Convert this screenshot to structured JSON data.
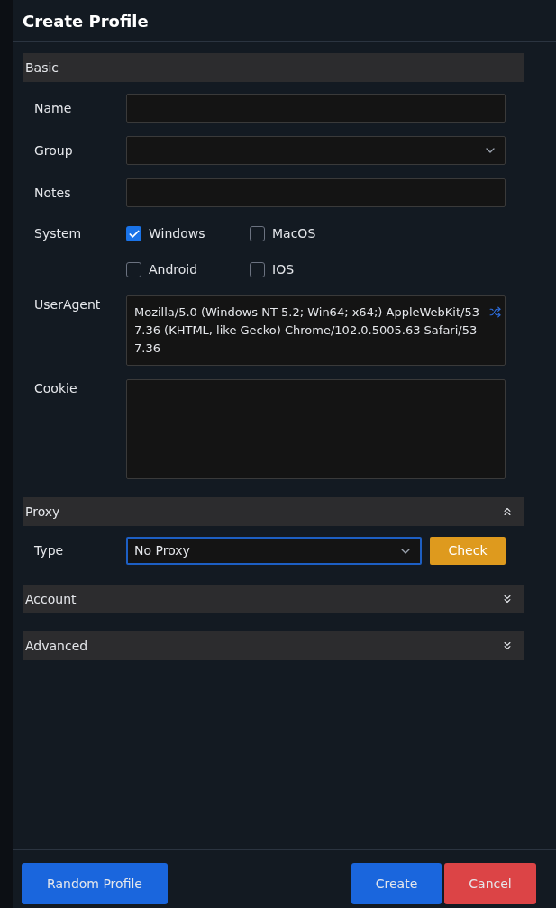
{
  "title": "Create Profile",
  "basic": {
    "header": "Basic",
    "fields": [
      {
        "label": "Name",
        "kind": "text"
      },
      {
        "label": "Group",
        "kind": "select"
      },
      {
        "label": "Notes",
        "kind": "text"
      }
    ],
    "system": {
      "label": "System",
      "options": [
        {
          "label": "Windows",
          "checked": true
        },
        {
          "label": "MacOS",
          "checked": false
        },
        {
          "label": "Android",
          "checked": false
        },
        {
          "label": "IOS",
          "checked": false
        }
      ]
    },
    "user_agent": {
      "label": "UserAgent",
      "value": "Mozilla/5.0 (Windows NT 5.2; Win64; x64;) AppleWebKit/537.36 (KHTML, like Gecko) Chrome/102.0.5005.63 Safari/537.36"
    },
    "cookie": {
      "label": "Cookie"
    }
  },
  "proxy": {
    "header": "Proxy",
    "expanded": true,
    "type_label": "Type",
    "type_value": "No Proxy",
    "check_button": "Check"
  },
  "collapsed_sections": [
    {
      "header": "Account",
      "expanded": false
    },
    {
      "header": "Advanced",
      "expanded": false
    }
  ],
  "footer": [
    {
      "label": "Random Profile",
      "kind": "primary"
    },
    {
      "label": "Create",
      "kind": "primary"
    },
    {
      "label": "Cancel",
      "kind": "danger"
    }
  ]
}
